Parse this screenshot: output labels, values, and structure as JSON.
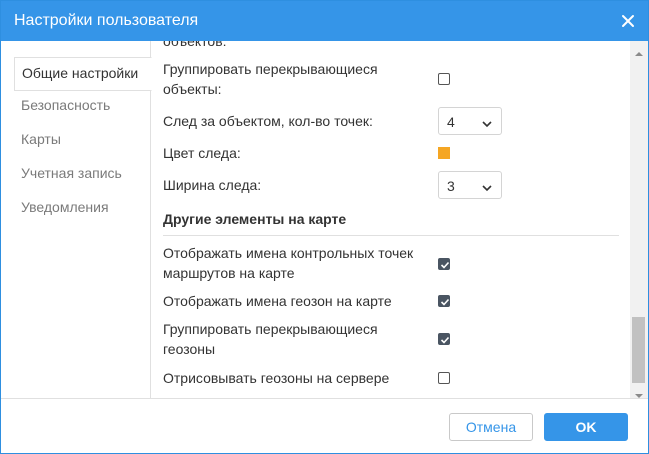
{
  "dialog": {
    "title": "Настройки пользователя",
    "colors": {
      "accent": "#3595e8",
      "trail_color": "#f5a623"
    }
  },
  "sidebar": {
    "items": [
      {
        "label": "Общие настройки",
        "active": true
      },
      {
        "label": "Безопасность",
        "active": false
      },
      {
        "label": "Карты",
        "active": false
      },
      {
        "label": "Учетная запись",
        "active": false
      },
      {
        "label": "Уведомления",
        "active": false
      }
    ]
  },
  "content": {
    "cut_text": "объектов:",
    "group_objects_line1": "Группировать перекрывающиеся",
    "group_objects_line2": "объекты:",
    "group_objects_checked": false,
    "trail_points_label": "След за объектом, кол-во точек:",
    "trail_points_value": "4",
    "trail_color_label": "Цвет следа:",
    "trail_width_label": "Ширина следа:",
    "trail_width_value": "3",
    "section_title": "Другие элементы на карте",
    "route_names_line1": "Отображать имена контрольных точек",
    "route_names_line2": "маршрутов на карте",
    "route_names_checked": true,
    "geofence_names_label": "Отображать имена геозон на карте",
    "geofence_names_checked": true,
    "group_geofences_line1": "Группировать перекрывающиеся",
    "group_geofences_line2": "геозоны",
    "group_geofences_checked": true,
    "render_geofences_label": "Отрисовывать геозоны на сервере",
    "render_geofences_checked": false
  },
  "footer": {
    "cancel_label": "Отмена",
    "ok_label": "OK"
  }
}
